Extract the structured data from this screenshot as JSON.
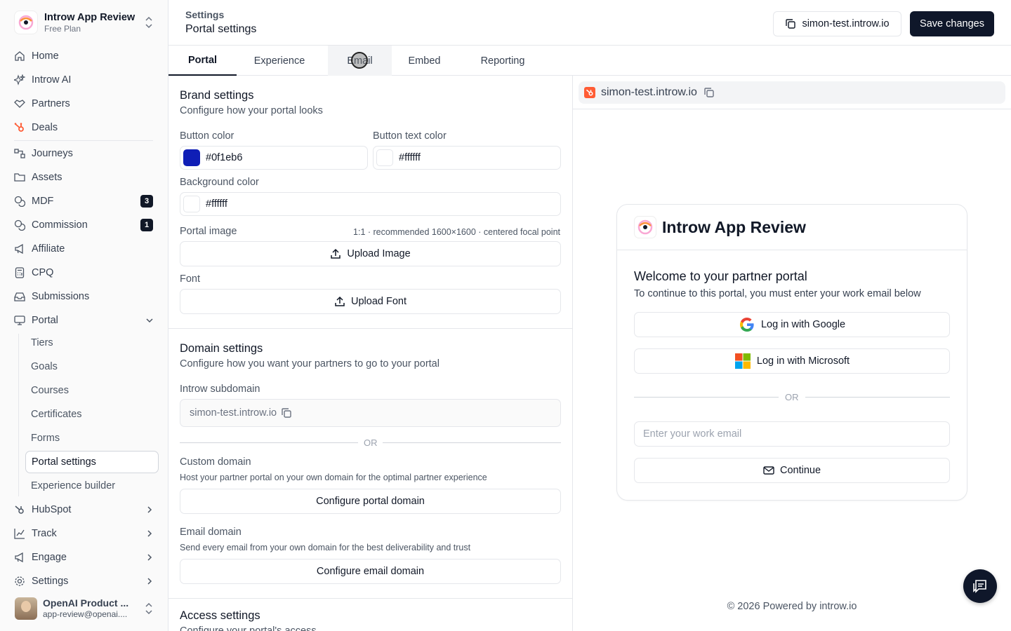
{
  "workspace": {
    "name": "Introw App Review",
    "plan": "Free Plan"
  },
  "sidebar": {
    "items": [
      {
        "label": "Home",
        "icon": "home-icon"
      },
      {
        "label": "Introw AI",
        "icon": "sparkles-icon"
      },
      {
        "label": "Partners",
        "icon": "handshake-icon"
      },
      {
        "label": "Deals",
        "icon": "hubspot-icon"
      },
      {
        "label": "Journeys",
        "icon": "workflow-icon"
      },
      {
        "label": "Assets",
        "icon": "folder-icon"
      },
      {
        "label": "MDF",
        "icon": "coins-icon",
        "badge": "3"
      },
      {
        "label": "Commission",
        "icon": "coins-icon",
        "badge": "1"
      },
      {
        "label": "Affiliate",
        "icon": "megaphone-icon"
      },
      {
        "label": "CPQ",
        "icon": "calculator-icon"
      },
      {
        "label": "Submissions",
        "icon": "inbox-icon"
      },
      {
        "label": "Portal",
        "icon": "monitor-icon"
      }
    ],
    "portal_sub": [
      "Tiers",
      "Goals",
      "Courses",
      "Certificates",
      "Forms",
      "Portal settings",
      "Experience builder"
    ],
    "bottom_items": [
      {
        "label": "HubSpot",
        "icon": "hubspot-icon"
      },
      {
        "label": "Track",
        "icon": "chart-icon"
      },
      {
        "label": "Engage",
        "icon": "megaphone-icon"
      },
      {
        "label": "Settings",
        "icon": "gear-icon"
      }
    ]
  },
  "user": {
    "name": "OpenAI Product ...",
    "email": "app-review@openai...."
  },
  "header": {
    "breadcrumb": "Settings",
    "title": "Portal settings",
    "domain_button": "simon-test.introw.io",
    "save_button": "Save changes"
  },
  "tabs": [
    "Portal",
    "Experience",
    "Email",
    "Embed",
    "Reporting"
  ],
  "brand": {
    "title": "Brand settings",
    "subtitle": "Configure how your portal looks",
    "button_color_label": "Button color",
    "button_color": "#0f1eb6",
    "button_text_color_label": "Button text color",
    "button_text_color": "#ffffff",
    "background_color_label": "Background color",
    "background_color": "#ffffff",
    "portal_image_label": "Portal image",
    "portal_image_hint": "1:1 · recommended 1600×1600 · centered focal point",
    "upload_image": "Upload Image",
    "font_label": "Font",
    "upload_font": "Upload Font"
  },
  "domain": {
    "title": "Domain settings",
    "subtitle": "Configure how you want your partners to go to your portal",
    "subdomain_label": "Introw subdomain",
    "subdomain_value": "simon-test.introw.io",
    "or": "OR",
    "custom_label": "Custom domain",
    "custom_hint": "Host your partner portal on your own domain for the optimal partner experience",
    "custom_button": "Configure portal domain",
    "email_label": "Email domain",
    "email_hint": "Send every email from your own domain for the best deliverability and trust",
    "email_button": "Configure email domain"
  },
  "access": {
    "title": "Access settings",
    "subtitle": "Configure your portal's access"
  },
  "preview": {
    "url": "simon-test.introw.io",
    "card_name": "Introw App Review",
    "welcome": "Welcome to your partner portal",
    "welcome_sub": "To continue to this portal, you must enter your work email below",
    "google": "Log in with Google",
    "microsoft": "Log in with Microsoft",
    "or": "OR",
    "email_placeholder": "Enter your work email",
    "continue": "Continue",
    "footer": "© 2026 Powered by introw.io"
  }
}
